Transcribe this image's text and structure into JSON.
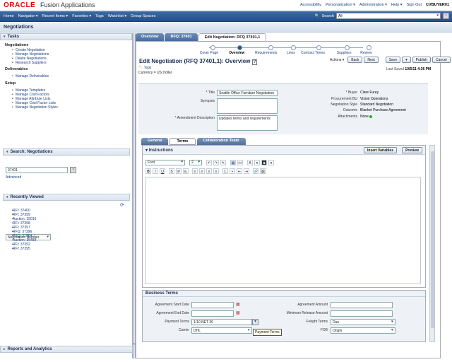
{
  "brand": {
    "logo": "ORACLE",
    "app": "Fusion Applications"
  },
  "toplinks": [
    "Accessibility",
    "Personalization ▾",
    "Administration ▾",
    "Help ▾",
    "Sign Out"
  ],
  "user": "CVBUYER01",
  "nav": [
    "Home",
    "Navigator ▾",
    "Recent Items ▾",
    "Favorites ▾",
    "Tags",
    "Watchlist ▾",
    "Group Spaces"
  ],
  "search": {
    "label": "Search",
    "scope": "All"
  },
  "regional": {
    "title": "Negotiations"
  },
  "tasks": {
    "title": "Tasks",
    "groups": [
      {
        "name": "Negotiations",
        "items": [
          "Create Negotiation",
          "Manage Negotiations",
          "Delete Negotiations",
          "Research Suppliers"
        ]
      },
      {
        "name": "Deliverables",
        "items": [
          "Manage Deliverables"
        ]
      },
      {
        "name": "Setup",
        "items": [
          "Manage Templates",
          "Manage Cost Factors",
          "Manage Attribute Lists",
          "Manage Cost Factor Lists",
          "Manage Negotiation Styles"
        ]
      }
    ]
  },
  "searchpanel": {
    "title": "Search: Negotiations",
    "field": "Negotiation Number",
    "value": "37401",
    "advanced": "Advanced"
  },
  "recent": {
    "title": "Recently Viewed",
    "items": [
      "RFI: 37400",
      "RFI: 37399",
      "Auction: 35016",
      "RFI: 37398",
      "RFI: 37397",
      "RFQ: 37396",
      "RFQ: 37064",
      "Auction: 35458",
      "RFI: 37392",
      "RFI: 37395"
    ]
  },
  "reports": {
    "title": "Reports and Analytics"
  },
  "tabs": [
    "Overview",
    "RFQ: 37401",
    "Edit Negotiation: RFQ 37401,1"
  ],
  "train": [
    "Cover Page",
    "Overview",
    "Requirements",
    "Lines",
    "Contract Terms",
    "Suppliers",
    "Review"
  ],
  "page": {
    "title": "Edit Negotiation (RFQ 37401,1): Overview",
    "tags": "Tags",
    "currency": "Currency = US Dollar",
    "lastsaved_label": "Last Saved",
    "lastsaved_value": "10/5/11 4:36 PM"
  },
  "actions": {
    "label": "Actions ▾",
    "back": "Back",
    "next": "Next",
    "save": "Save",
    "publish": "Publish",
    "cancel": "Cancel"
  },
  "form": {
    "title_label": "Title",
    "title_value": "Seattle Office Furniture Negotiation",
    "synopsis_label": "Synopsis",
    "amend_label": "Amendment Description",
    "amend_value": "Updates terms and requirements",
    "buyer_label": "Buyer",
    "buyer_value": "Clare Furey",
    "bu_label": "Procurement BU",
    "bu_value": "Vision Operations",
    "style_label": "Negotiation Style",
    "style_value": "Standard Negotiation",
    "outcome_label": "Outcome",
    "outcome_value": "Blanket Purchase Agreement",
    "attach_label": "Attachments",
    "attach_value": "None"
  },
  "subtabs": [
    "General",
    "Terms",
    "Collaboration Team"
  ],
  "instructions": {
    "title": "Instructions",
    "insert": "Insert Variables",
    "preview": "Preview",
    "font": "Font",
    "size": "2"
  },
  "business": {
    "title": "Business Terms",
    "start_label": "Agreement Start Date",
    "end_label": "Agreement End Date",
    "payment_label": "Payment Terms",
    "payment_value": "1/10 NET 30",
    "carrier_label": "Carrier",
    "carrier_value": "DHL",
    "amount_label": "Agreement Amount",
    "minrel_label": "Minimum Release Amount",
    "freight_label": "Freight Terms",
    "freight_value": "Due",
    "fob_label": "FOB",
    "fob_value": "Origin",
    "tooltip": "Payment Terms"
  }
}
